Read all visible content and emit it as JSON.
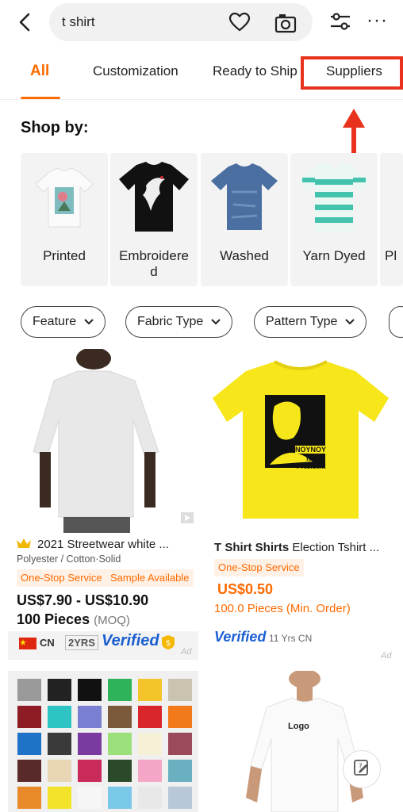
{
  "search": {
    "query": "t shirt"
  },
  "header": {
    "more_label": "···"
  },
  "tabs": [
    "All",
    "Customization",
    "Ready to Ship",
    "Suppliers"
  ],
  "shop_by": {
    "title": "Shop by:",
    "items": [
      {
        "label": "Printed"
      },
      {
        "label": "Embroidere d"
      },
      {
        "label": "Washed"
      },
      {
        "label": "Yarn Dyed"
      },
      {
        "label": "Pl"
      }
    ]
  },
  "filters": [
    "Feature",
    "Fabric Type",
    "Pattern Type"
  ],
  "products": [
    {
      "title": "2021 Streetwear white ...",
      "subtitle": "Polyester / Cotton·Solid",
      "tags": [
        "One-Stop Service",
        "Sample Available"
      ],
      "price": "US$7.90 - US$10.90",
      "moq_qty": "100 Pieces",
      "moq_label": "(MOQ)",
      "country": "CN",
      "years": "2YRS",
      "verified": "Verified",
      "ad": "Ad"
    },
    {
      "title_bold": "T Shirt Shirts",
      "title_rest": " Election Tshirt ...",
      "tags": [
        "One-Stop Service"
      ],
      "price": "US$0.50",
      "moq": "100.0 Pieces (Min. Order)",
      "verified": "Verified",
      "supplier_info": "11 Yrs CN",
      "ad": "Ad",
      "shirt_text_1": "NOYNOY",
      "shirt_text_2": "for",
      "shirt_text_3": "President"
    },
    {
      "image": "colorful-tshirts-grid"
    },
    {
      "shirt_text": "Logo"
    }
  ],
  "colors": {
    "accent": "#ff6a00",
    "highlight": "#e8321e",
    "verified": "#1a5fd1"
  }
}
